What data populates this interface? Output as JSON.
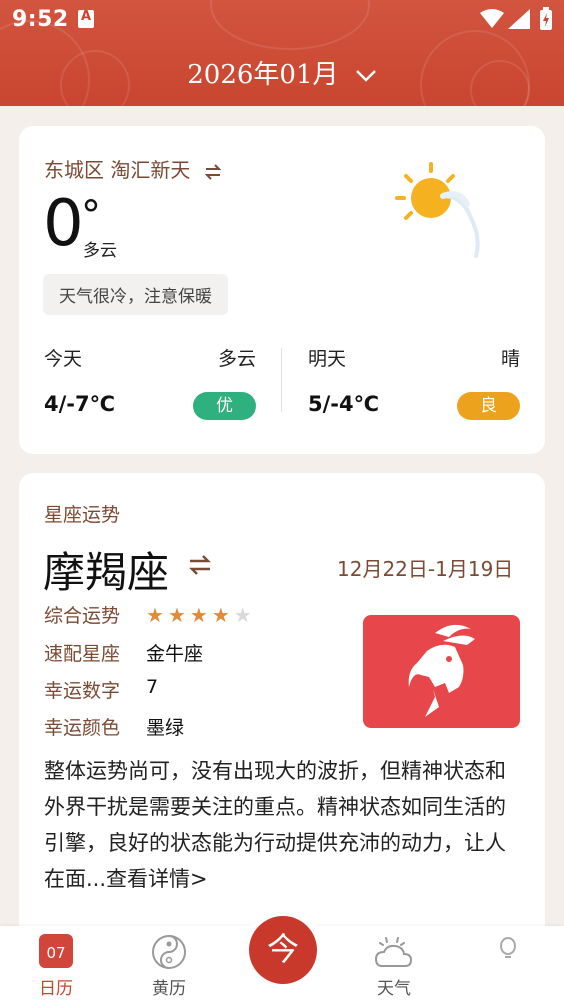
{
  "status_bar": {
    "time": "9:52"
  },
  "header": {
    "month": "2026年01月"
  },
  "weather": {
    "location": "东城区 淘汇新天",
    "temperature": "0",
    "degree_symbol": "°",
    "condition": "多云",
    "tip": "天气很冷，注意保暖",
    "today": {
      "label": "今天",
      "condition": "多云",
      "range": "4/-7℃",
      "aqi": "优"
    },
    "tomorrow": {
      "label": "明天",
      "condition": "晴",
      "range": "5/-4℃",
      "aqi": "良"
    }
  },
  "horoscope": {
    "section_title": "星座运势",
    "sign": "摩羯座",
    "date_range": "12月22日-1月19日",
    "overall_label": "综合运势",
    "overall_rating": 4,
    "overall_max": 5,
    "match_label": "速配星座",
    "match_value": "金牛座",
    "lucky_number_label": "幸运数字",
    "lucky_number_value": "7",
    "lucky_color_label": "幸运颜色",
    "lucky_color_value": "墨绿",
    "description": "整体运势尚可，没有出现大的波折，但精神状态和外界干扰是需要关注的重点。精神状态如同生活的引擎，良好的状态能为行动提供充沛的动力，让人在面...查看详情>"
  },
  "bottom_nav": {
    "calendar_day": "07",
    "calendar_label": "日历",
    "huangli_label": "黄历",
    "center_label": "今",
    "weather_label": "天气"
  },
  "colors": {
    "brand_red": "#c9452f",
    "aqi_good": "#2fb07f",
    "aqi_fair": "#eda21d",
    "label_brown": "#7b4a34",
    "goat_bg": "#e7474b"
  }
}
